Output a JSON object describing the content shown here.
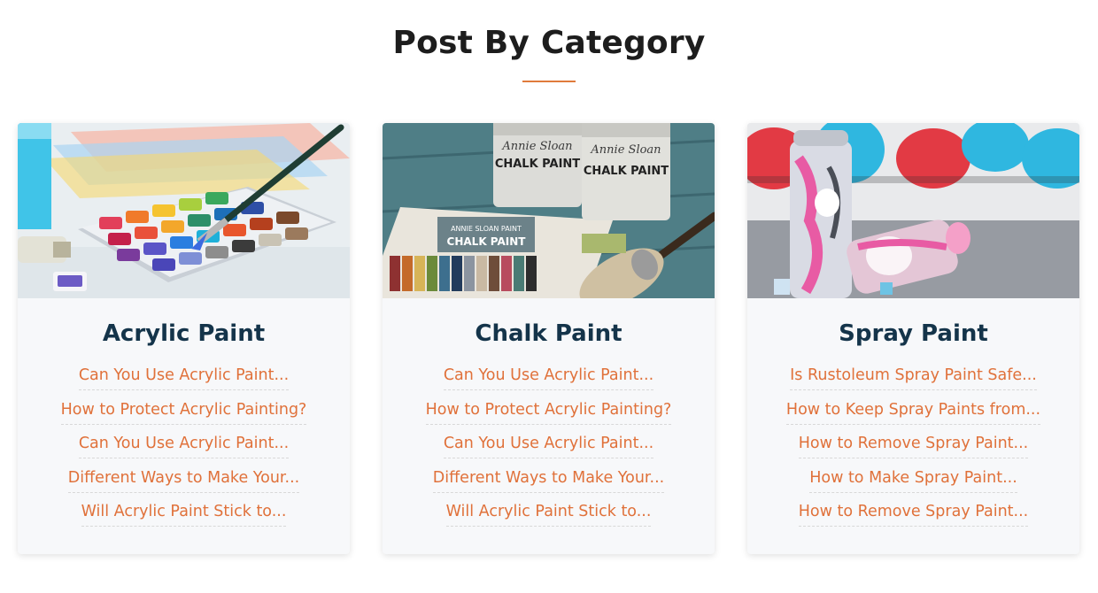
{
  "section": {
    "title": "Post By Category",
    "accent_color": "#e07b3c",
    "title_color": "#14344a",
    "link_color": "#e0713a"
  },
  "categories": [
    {
      "title": "Acrylic Paint",
      "image": "watercolor-palette-with-brush",
      "links": [
        "Can You Use Acrylic Paint...",
        "How to Protect Acrylic Painting?",
        "Can You Use Acrylic Paint...",
        "Different Ways to Make Your...",
        "Will Acrylic Paint Stick to..."
      ]
    },
    {
      "title": "Chalk Paint",
      "image": "chalk-paint-cans-and-brush",
      "links": [
        "Can You Use Acrylic Paint...",
        "How to Protect Acrylic Painting?",
        "Can You Use Acrylic Paint...",
        "Different Ways to Make Your...",
        "Will Acrylic Paint Stick to..."
      ]
    },
    {
      "title": "Spray Paint",
      "image": "spray-paint-cans-graffiti",
      "links": [
        "Is Rustoleum Spray Paint Safe...",
        "How to Keep Spray Paints from...",
        "How to Remove Spray Paint...",
        "How to Make Spray Paint...",
        "How to Remove Spray Paint..."
      ]
    }
  ],
  "image_labels": {
    "can_brand": "Annie Sloan",
    "can_label": "CHALK PAINT",
    "card_label": "CHALK PAINT"
  }
}
